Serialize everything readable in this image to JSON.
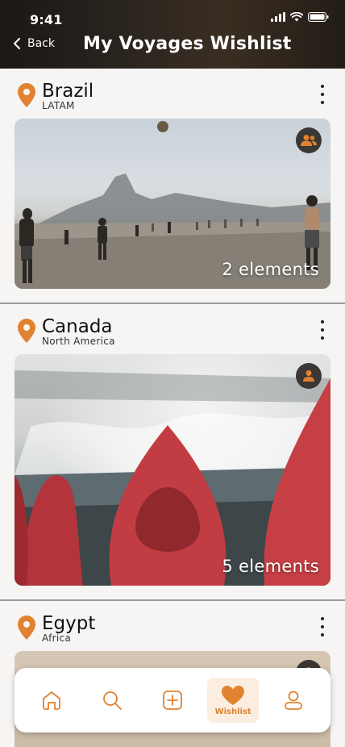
{
  "status_bar": {
    "time": "9:41"
  },
  "header": {
    "back_label": "Back",
    "title": "My Voyages Wishlist"
  },
  "colors": {
    "accent": "#e0822f",
    "header_bg": "#2a241f",
    "badge_bg": "#3b3734"
  },
  "wishlists": [
    {
      "name": "Brazil",
      "region": "LATAM",
      "count": "2 elements",
      "badge_icon": "group-icon"
    },
    {
      "name": "Canada",
      "region": "North America",
      "count": "5 elements",
      "badge_icon": "person-icon"
    },
    {
      "name": "Egypt",
      "region": "Africa",
      "count": "",
      "badge_icon": "person-icon"
    }
  ],
  "bottom_nav": {
    "items": [
      {
        "icon": "home-icon",
        "label": ""
      },
      {
        "icon": "search-icon",
        "label": ""
      },
      {
        "icon": "add-icon",
        "label": ""
      },
      {
        "icon": "heart-icon",
        "label": "Wishlist",
        "active": true
      },
      {
        "icon": "profile-icon",
        "label": ""
      }
    ]
  }
}
